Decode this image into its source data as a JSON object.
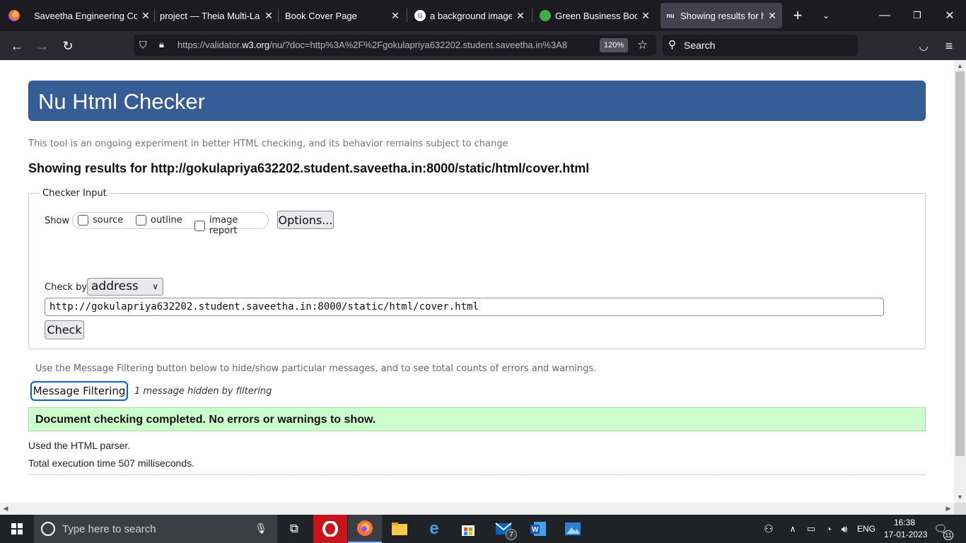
{
  "tabs": [
    {
      "title": "Saveetha Engineering Colle",
      "icon": "saveetha-favicon"
    },
    {
      "title": "project — Theia Multi-Lang",
      "icon": "theia-favicon"
    },
    {
      "title": "Book Cover Page",
      "icon": "blank-favicon"
    },
    {
      "title": "a background image fo",
      "icon": "google-favicon"
    },
    {
      "title": "Green Business Book C",
      "icon": "green-favicon"
    },
    {
      "title": "Showing results for htt",
      "icon": "nu-favicon",
      "icon_text": "nu"
    }
  ],
  "nav": {
    "url_prefix": "https://validator.",
    "url_domain": "w3.org",
    "url_rest": "/nu/?doc=http%3A%2F%2Fgokulapriya632202.student.saveetha.in%3A8",
    "zoom": "120%",
    "search_label": "Search"
  },
  "page": {
    "banner_title": "Nu Html Checker",
    "tagline": "This tool is an ongoing experiment in better HTML checking, and its behavior remains subject to change",
    "results_heading": "Showing results for http://gokulapriya632202.student.saveetha.in:8000/static/html/cover.html",
    "checker": {
      "legend": "Checker Input",
      "show_label": "Show",
      "options": [
        {
          "label": "source",
          "checked": false
        },
        {
          "label": "outline",
          "checked": false
        },
        {
          "label": "image report",
          "checked": false
        }
      ],
      "options_button": "Options...",
      "check_by_label": "Check by",
      "check_by_value": "address",
      "url_value": "http://gokulapriya632202.student.saveetha.in:8000/static/html/cover.html",
      "check_button": "Check"
    },
    "filter_hint": "Use the Message Filtering button below to hide/show particular messages, and to see total counts of errors and warnings.",
    "filter_button": "Message Filtering",
    "filter_note": "1 message hidden by filtering",
    "success_message": "Document checking completed. No errors or warnings to show.",
    "parser_note": "Used the HTML parser.",
    "exec_note": "Total execution time 507 milliseconds."
  },
  "taskbar": {
    "search_placeholder": "Type here to search",
    "mail_badge": "7",
    "language": "ENG",
    "time": "16:38",
    "date": "17-01-2023",
    "notification_count": "11"
  },
  "colors": {
    "banner": "#365d95",
    "success_bg": "#ccffcc",
    "focus_ring": "#0060df"
  }
}
